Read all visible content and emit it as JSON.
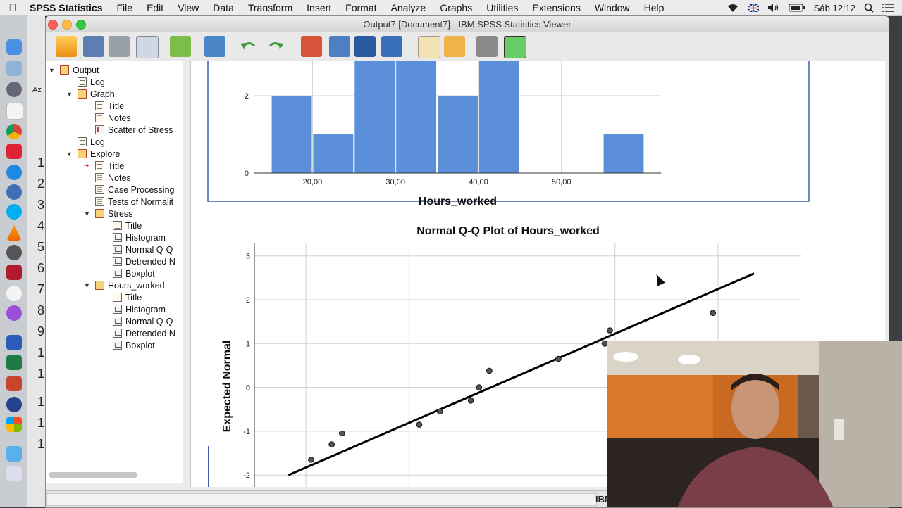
{
  "menubar": {
    "app_name": "SPSS Statistics",
    "items": [
      "File",
      "Edit",
      "View",
      "Data",
      "Transform",
      "Insert",
      "Format",
      "Analyze",
      "Graphs",
      "Utilities",
      "Extensions",
      "Window",
      "Help"
    ],
    "clock": "Sáb 12:12"
  },
  "window": {
    "title": "Output7 [Document7] - IBM SPSS Statistics Viewer"
  },
  "background_window": {
    "row_numbers": [
      "1",
      "2",
      "3",
      "4",
      "5",
      "6",
      "7",
      "8",
      "9",
      "1",
      "1",
      "1",
      "1",
      "1"
    ],
    "label": "Az"
  },
  "outline": {
    "items": [
      {
        "label": "Output",
        "level": 0,
        "icon": "book",
        "expanded": true
      },
      {
        "label": "Log",
        "level": 1,
        "icon": "doc",
        "expanded": null
      },
      {
        "label": "Graph",
        "level": 1,
        "icon": "book",
        "expanded": true
      },
      {
        "label": "Title",
        "level": 2,
        "icon": "doc",
        "expanded": null
      },
      {
        "label": "Notes",
        "level": 2,
        "icon": "grid",
        "expanded": null
      },
      {
        "label": "Scatter of Stress",
        "level": 2,
        "icon": "chart",
        "expanded": null
      },
      {
        "label": "Log",
        "level": 1,
        "icon": "doc",
        "expanded": null
      },
      {
        "label": "Explore",
        "level": 1,
        "icon": "book",
        "expanded": true
      },
      {
        "label": "Title",
        "level": 2,
        "icon": "doc",
        "expanded": null,
        "current": true
      },
      {
        "label": "Notes",
        "level": 2,
        "icon": "grid",
        "expanded": null
      },
      {
        "label": "Case Processing",
        "level": 2,
        "icon": "grid",
        "expanded": null
      },
      {
        "label": "Tests of Normalit",
        "level": 2,
        "icon": "grid",
        "expanded": null
      },
      {
        "label": "Stress",
        "level": 2,
        "icon": "book",
        "expanded": true
      },
      {
        "label": "Title",
        "level": 3,
        "icon": "doc",
        "expanded": null
      },
      {
        "label": "Histogram",
        "level": 3,
        "icon": "chart",
        "expanded": null
      },
      {
        "label": "Normal Q-Q",
        "level": 3,
        "icon": "chart",
        "expanded": null
      },
      {
        "label": "Detrended N",
        "level": 3,
        "icon": "chart",
        "expanded": null
      },
      {
        "label": "Boxplot",
        "level": 3,
        "icon": "chart",
        "expanded": null
      },
      {
        "label": "Hours_worked",
        "level": 2,
        "icon": "book",
        "expanded": true
      },
      {
        "label": "Title",
        "level": 3,
        "icon": "doc",
        "expanded": null
      },
      {
        "label": "Histogram",
        "level": 3,
        "icon": "chart",
        "expanded": null
      },
      {
        "label": "Normal Q-Q",
        "level": 3,
        "icon": "chart",
        "expanded": null
      },
      {
        "label": "Detrended N",
        "level": 3,
        "icon": "chart",
        "expanded": null
      },
      {
        "label": "Boxplot",
        "level": 3,
        "icon": "chart",
        "expanded": null
      }
    ]
  },
  "status": {
    "text": "",
    "ibm": "IBM"
  },
  "colors": {
    "bar_fill": "#5b8fd9",
    "frame_border": "#3a5fa8",
    "line": "#000000"
  },
  "chart_data": [
    {
      "type": "bar",
      "title": "",
      "xlabel": "Hours_worked",
      "ylabel": "",
      "categories": [
        "15-20",
        "20-25",
        "25-30",
        "30-35",
        "35-40",
        "40-45",
        "45-50",
        "50-55",
        "55-60"
      ],
      "values": [
        2,
        1,
        3,
        3,
        2,
        3,
        0,
        0,
        1
      ],
      "xticks": [
        "20,00",
        "30,00",
        "40,00",
        "50,00"
      ],
      "xtick_values": [
        20,
        30,
        40,
        50
      ],
      "xlim": [
        13,
        62
      ],
      "ylim": [
        0,
        2.4
      ],
      "yticks": [
        "0",
        "2"
      ],
      "ytick_values": [
        0,
        2
      ],
      "grid": true
    },
    {
      "type": "scatter",
      "title": "Normal Q-Q Plot of Hours_worked",
      "xlabel": "",
      "ylabel": "Expected Normal",
      "yticks": [
        "3",
        "2",
        "1",
        "0",
        "-1",
        "-2"
      ],
      "ytick_values": [
        3,
        2,
        1,
        0,
        -1,
        -2
      ],
      "ylim": [
        -2.35,
        3.3
      ],
      "xlim": [
        15,
        68
      ],
      "points": [
        {
          "x": 20.5,
          "y": -1.65
        },
        {
          "x": 22.5,
          "y": -1.3
        },
        {
          "x": 23.5,
          "y": -1.05
        },
        {
          "x": 31.0,
          "y": -0.85
        },
        {
          "x": 33.0,
          "y": -0.55
        },
        {
          "x": 36.0,
          "y": -0.3
        },
        {
          "x": 36.8,
          "y": 0.0
        },
        {
          "x": 37.8,
          "y": 0.38
        },
        {
          "x": 44.5,
          "y": 0.65
        },
        {
          "x": 49.0,
          "y": 1.0
        },
        {
          "x": 49.5,
          "y": 1.3
        },
        {
          "x": 59.5,
          "y": 1.7
        }
      ],
      "reference_line": [
        {
          "x": 18.3,
          "y": -2.0
        },
        {
          "x": 63.5,
          "y": 2.6
        }
      ],
      "grid": true
    }
  ]
}
